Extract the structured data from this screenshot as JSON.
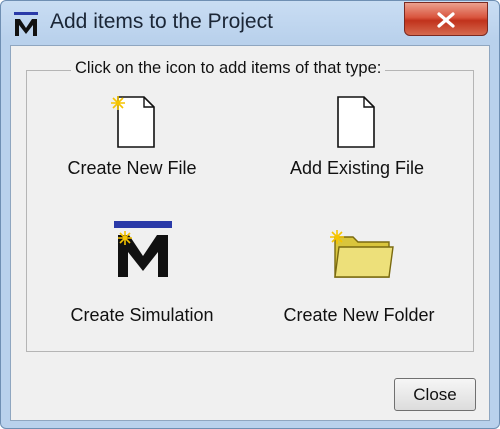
{
  "window": {
    "title": "Add items to the Project"
  },
  "dialog": {
    "prompt": "Click on the icon to add items of that type:",
    "items": [
      {
        "label": "Create New File",
        "icon": "new-file-icon"
      },
      {
        "label": "Add Existing File",
        "icon": "existing-file-icon"
      },
      {
        "label": "Create Simulation",
        "icon": "simulation-icon"
      },
      {
        "label": "Create New Folder",
        "icon": "new-folder-icon"
      }
    ],
    "close_label": "Close"
  },
  "colors": {
    "title_bar": "#b9d1ec",
    "close_button_red": "#c1321c",
    "folder_yellow": "#e8d750",
    "app_icon_bar": "#2a3aa8"
  }
}
